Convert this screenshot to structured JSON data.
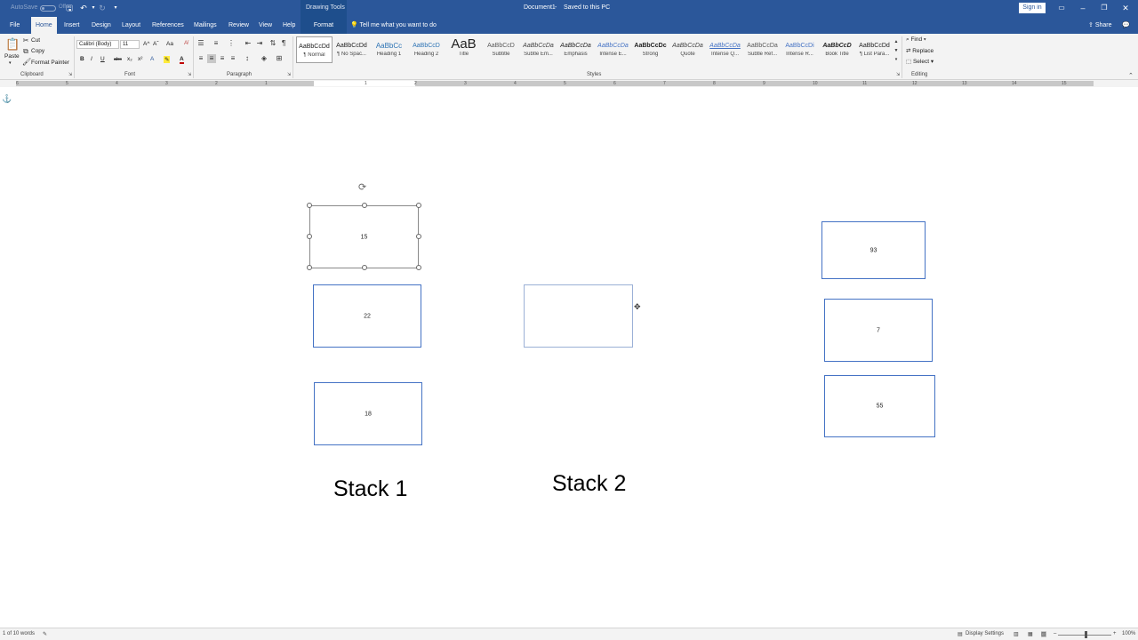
{
  "titlebar": {
    "autosave_label": "AutoSave",
    "autosave_state": "Off",
    "drawing_tools": "Drawing Tools",
    "document_title": "Document1",
    "saved_status": "Saved to this PC",
    "sign_in": "Sign in"
  },
  "tabs": {
    "file": "File",
    "home": "Home",
    "insert": "Insert",
    "design": "Design",
    "layout": "Layout",
    "references": "References",
    "mailings": "Mailings",
    "review": "Review",
    "view": "View",
    "help": "Help",
    "format": "Format",
    "tell_me": "Tell me what you want to do",
    "share": "Share"
  },
  "clipboard": {
    "paste": "Paste",
    "cut": "Cut",
    "copy": "Copy",
    "format_painter": "Format Painter",
    "label": "Clipboard"
  },
  "font": {
    "family": "Calibri (Body)",
    "size": "11",
    "label": "Font",
    "bold": "B",
    "italic": "I",
    "underline": "U",
    "strike": "abc",
    "subscript": "x₂",
    "superscript": "x²",
    "grow": "A^",
    "shrink": "Aˇ",
    "case": "Aa",
    "color_letter": "A"
  },
  "paragraph": {
    "label": "Paragraph",
    "pilcrow": "¶"
  },
  "styles": {
    "label": "Styles",
    "items": [
      {
        "sample": "AaBbCcDd",
        "name": "¶ Normal"
      },
      {
        "sample": "AaBbCcDd",
        "name": "¶ No Spac..."
      },
      {
        "sample": "AaBbCc",
        "name": "Heading 1"
      },
      {
        "sample": "AaBbCcD",
        "name": "Heading 2"
      },
      {
        "sample": "AaB",
        "name": "Title"
      },
      {
        "sample": "AaBbCcD",
        "name": "Subtitle"
      },
      {
        "sample": "AaBbCcDa",
        "name": "Subtle Em..."
      },
      {
        "sample": "AaBbCcDa",
        "name": "Emphasis"
      },
      {
        "sample": "AaBbCcDa",
        "name": "Intense E..."
      },
      {
        "sample": "AaBbCcDc",
        "name": "Strong"
      },
      {
        "sample": "AaBbCcDa",
        "name": "Quote"
      },
      {
        "sample": "AaBbCcDa",
        "name": "Intense Q..."
      },
      {
        "sample": "AaBbCcDa",
        "name": "Subtle Ref..."
      },
      {
        "sample": "AaBbCcDi",
        "name": "Intense R..."
      },
      {
        "sample": "AaBbCcD",
        "name": "Book Title"
      },
      {
        "sample": "AaBbCcDd",
        "name": "¶ List Para..."
      }
    ]
  },
  "editing": {
    "find": "Find",
    "replace": "Replace",
    "select": "Select",
    "label": "Editing"
  },
  "ruler": {
    "numbers": [
      "6",
      "5",
      "4",
      "3",
      "2",
      "1",
      "1",
      "2",
      "3",
      "4",
      "5",
      "6",
      "7",
      "8",
      "9",
      "10",
      "11",
      "12",
      "13",
      "14",
      "15"
    ]
  },
  "document": {
    "stack1_boxes": [
      "15",
      "22",
      "18"
    ],
    "stack2_boxes": [
      ""
    ],
    "stack3_boxes": [
      "93",
      "7",
      "55"
    ],
    "stack1_label": "Stack 1",
    "stack2_label": "Stack 2"
  },
  "statusbar": {
    "word_count": "1 of 10 words",
    "display_settings": "Display Settings",
    "zoom": "100%"
  },
  "colors": {
    "title_bar": "#2b579a",
    "ribbon": "#f3f3f3",
    "shape_outline": "#4472c4"
  }
}
